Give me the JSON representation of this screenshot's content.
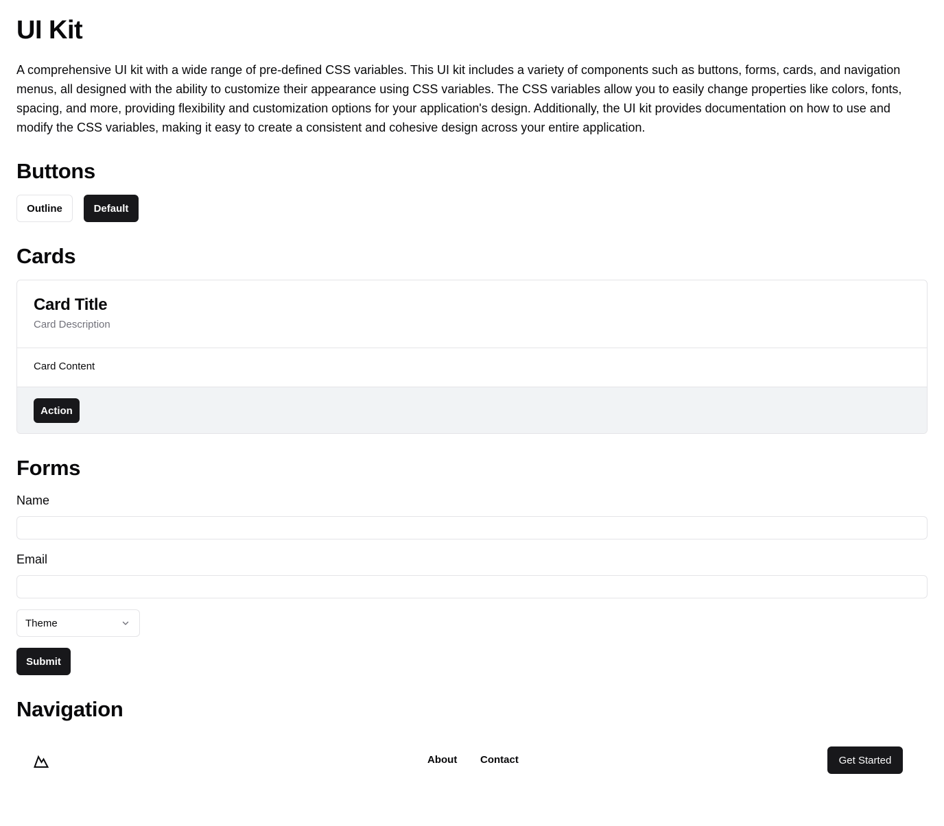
{
  "page": {
    "title": "UI Kit",
    "intro": "A comprehensive UI kit with a wide range of pre-defined CSS variables. This UI kit includes a variety of components such as buttons, forms, cards, and navigation menus, all designed with the ability to customize their appearance using CSS variables. The CSS variables allow you to easily change properties like colors, fonts, spacing, and more, providing flexibility and customization options for your application's design. Additionally, the UI kit provides documentation on how to use and modify the CSS variables, making it easy to create a consistent and cohesive design across your entire application."
  },
  "sections": {
    "buttons": "Buttons",
    "cards": "Cards",
    "forms": "Forms",
    "navigation": "Navigation"
  },
  "buttons": {
    "outline_label": "Outline",
    "default_label": "Default"
  },
  "card": {
    "title": "Card Title",
    "description": "Card Description",
    "content": "Card Content",
    "action_label": "Action"
  },
  "form": {
    "name_label": "Name",
    "name_value": "",
    "email_label": "Email",
    "email_value": "",
    "select_value": "Theme",
    "submit_label": "Submit"
  },
  "nav": {
    "logo_icon": "mountain-icon",
    "links": [
      "About",
      "Contact"
    ],
    "cta_label": "Get Started"
  },
  "colors": {
    "primary": "#18181b",
    "primary_text": "#fafafa",
    "border": "#e4e4e7",
    "muted_text": "#71717a",
    "muted_bg": "#f1f3f5"
  }
}
